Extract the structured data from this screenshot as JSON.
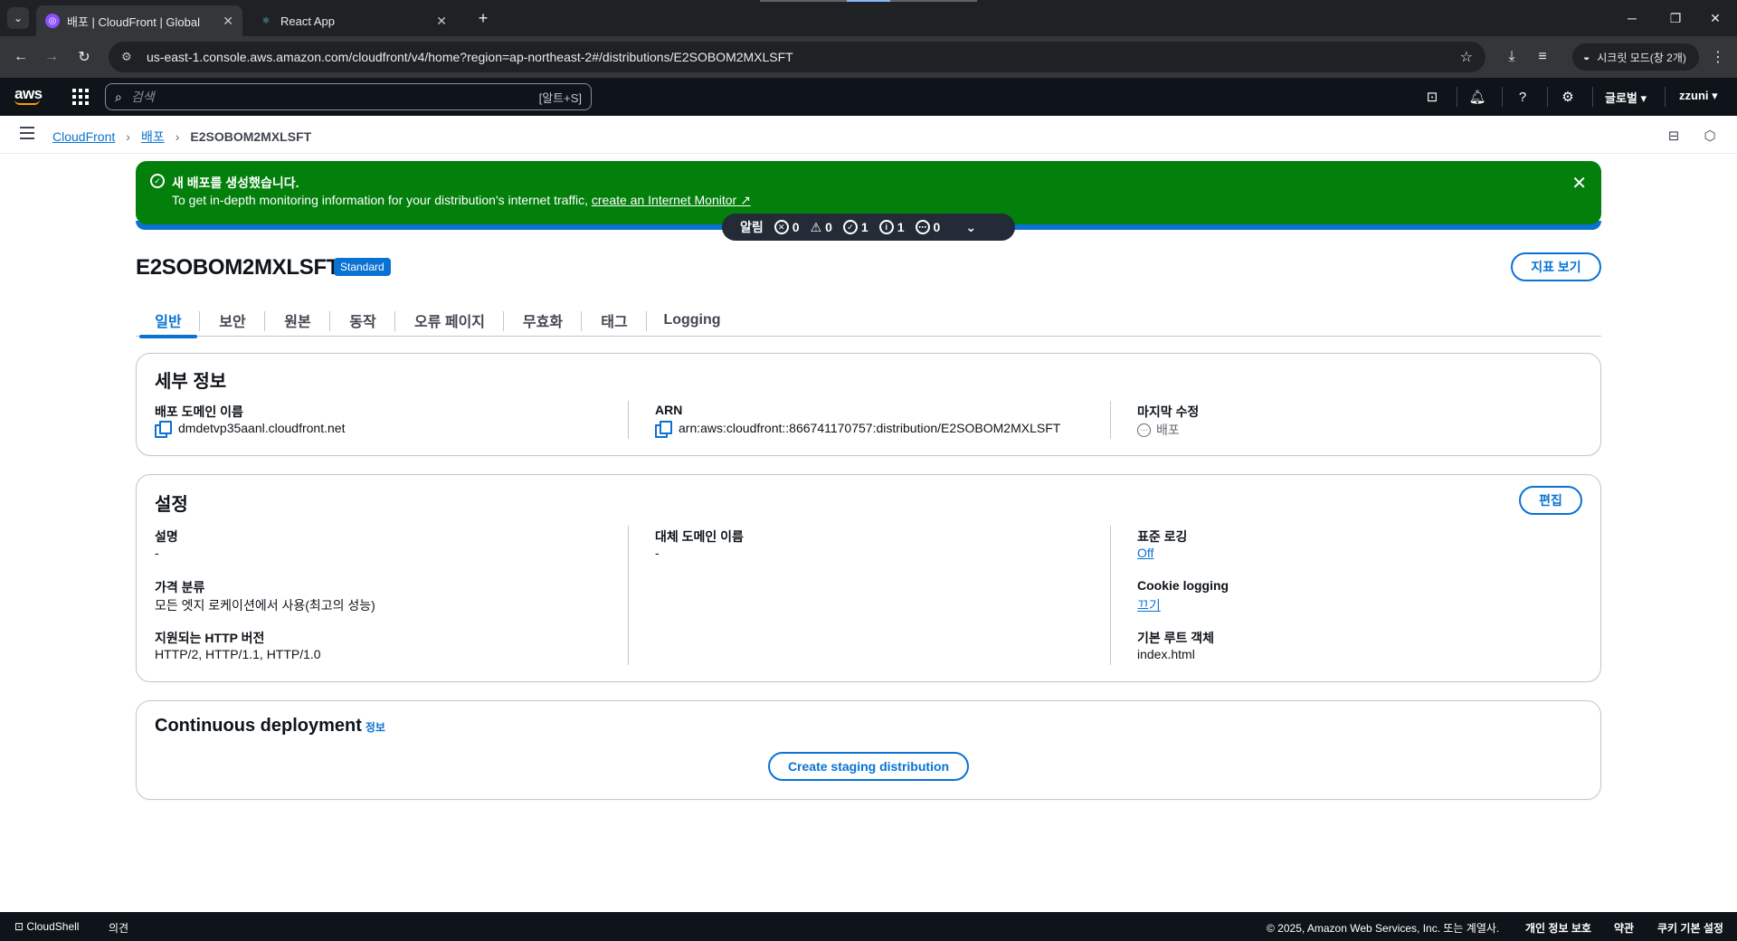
{
  "browser": {
    "tabs": [
      {
        "title": "배포 | CloudFront | Global",
        "active": true,
        "icon": "cloudfront-favicon"
      },
      {
        "title": "React App",
        "active": false,
        "icon": "react-favicon"
      }
    ],
    "url": "us-east-1.console.aws.amazon.com/cloudfront/v4/home?region=ap-northeast-2#/distributions/E2SOBOM2MXLSFT",
    "incognito_label": "시크릿 모드(창 2개)"
  },
  "aws_nav": {
    "logo": "aws",
    "search_placeholder": "검색",
    "search_shortcut": "[알트+S]",
    "region": "글로벌",
    "user": "zzuni"
  },
  "breadcrumb": {
    "items": [
      "CloudFront",
      "배포"
    ],
    "current": "E2SOBOM2MXLSFT"
  },
  "flash": {
    "title": "새 배포를 생성했습니다.",
    "body": "To get in-depth monitoring information for your distribution's internet traffic,",
    "link": "create an Internet Monitor",
    "color": "#037f0c"
  },
  "notifications": {
    "label": "알림",
    "error_count": "0",
    "warning_count": "0",
    "success_count": "1",
    "info_count": "1",
    "pending_count": "0"
  },
  "page": {
    "title": "E2SOBOM2MXLSFT",
    "badge": "Standard",
    "metrics_button": "지표 보기"
  },
  "tabs": [
    "일반",
    "보안",
    "원본",
    "동작",
    "오류 페이지",
    "무효화",
    "태그",
    "Logging"
  ],
  "details": {
    "heading": "세부 정보",
    "domain_label": "배포 도메인 이름",
    "domain_value": "dmdetvp35aanl.cloudfront.net",
    "arn_label": "ARN",
    "arn_value": "arn:aws:cloudfront::866741170757:distribution/E2SOBOM2MXLSFT",
    "modified_label": "마지막 수정",
    "modified_value": "배포"
  },
  "settings": {
    "heading": "설정",
    "edit_button": "편집",
    "description_label": "설명",
    "description_value": "-",
    "price_label": "가격 분류",
    "price_value": "모든 엣지 로케이션에서 사용(최고의 성능)",
    "http_label": "지원되는 HTTP 버전",
    "http_value": "HTTP/2, HTTP/1.1, HTTP/1.0",
    "alt_domain_label": "대체 도메인 이름",
    "alt_domain_value": "-",
    "std_logging_label": "표준 로깅",
    "std_logging_value": "Off",
    "cookie_logging_label": "Cookie logging",
    "cookie_logging_value": "끄기",
    "root_object_label": "기본 루트 객체",
    "root_object_value": "index.html"
  },
  "continuous": {
    "heading": "Continuous deployment",
    "info": "정보",
    "button": "Create staging distribution"
  },
  "footer": {
    "cloudshell": "CloudShell",
    "feedback": "의견",
    "copyright": "© 2025, Amazon Web Services, Inc. 또는 계열사.",
    "privacy": "개인 정보 보호",
    "terms": "약관",
    "cookies": "쿠키 기본 설정"
  },
  "colors": {
    "accent": "#0972d3",
    "success": "#037f0c",
    "nav_bg": "#0f141a"
  }
}
